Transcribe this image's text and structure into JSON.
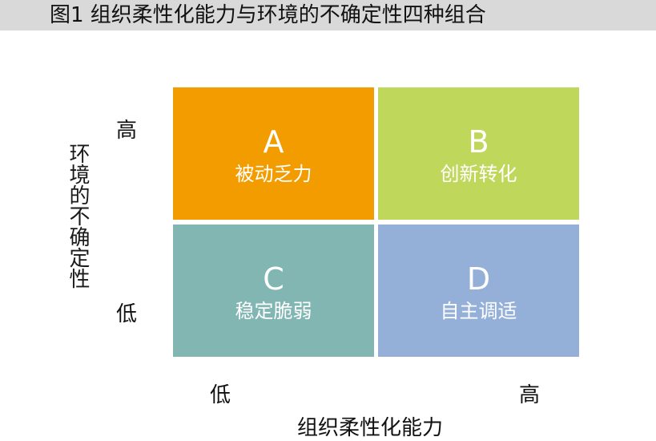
{
  "title": "图1  组织柔性化能力与环境的不确定性四种组合",
  "axes": {
    "y_title": "环境的不确定性",
    "y_high": "高",
    "y_low": "低",
    "x_title": "组织柔性化能力",
    "x_low": "低",
    "x_high": "高"
  },
  "quadrants": [
    {
      "letter": "A",
      "name": "被动乏力",
      "color": "#f39c00"
    },
    {
      "letter": "B",
      "name": "创新转化",
      "color": "#bfd85c"
    },
    {
      "letter": "C",
      "name": "稳定脆弱",
      "color": "#82b6b3"
    },
    {
      "letter": "D",
      "name": "自主调适",
      "color": "#94b0d8"
    }
  ]
}
